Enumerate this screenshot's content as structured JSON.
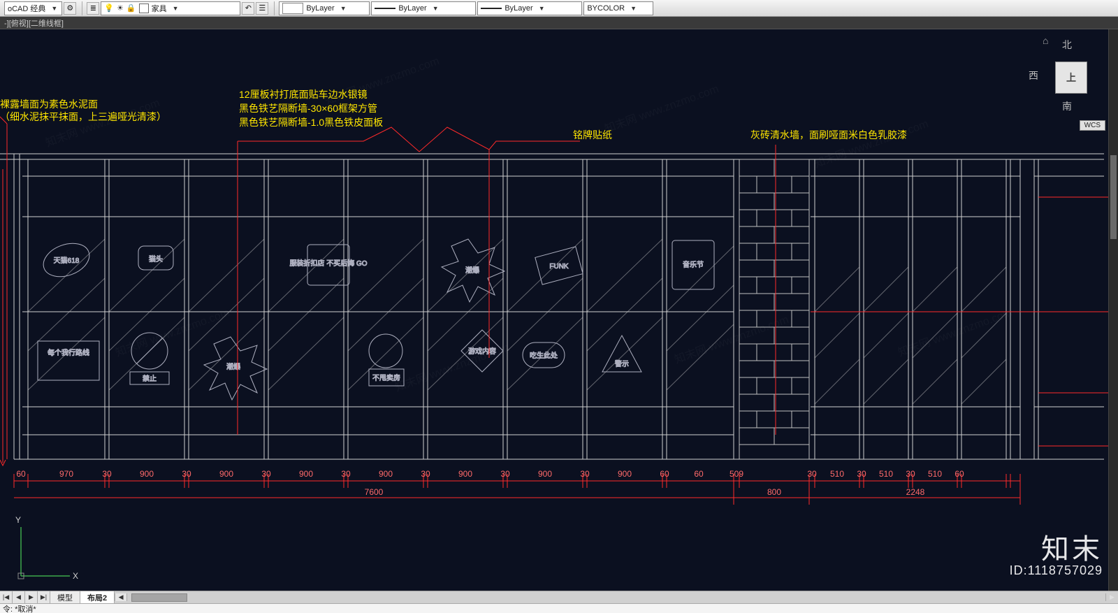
{
  "toolbar": {
    "workspace": "oCAD 经典",
    "layer_dropdown": "家具",
    "linetype": "ByLayer",
    "lineweight": "ByLayer",
    "plotstyle": "ByLayer",
    "color": "BYCOLOR",
    "icons": {
      "bulb": "bulb-icon",
      "sun": "sun-icon",
      "lock": "lock-icon",
      "layer": "layer-icon",
      "layerprops": "layer-properties-icon",
      "layprev": "layer-previous-icon"
    }
  },
  "viewport_label": "-][俯视][二维线框]",
  "wcs_badge": "WCS",
  "viewcube": {
    "north": "北",
    "south": "南",
    "west": "西",
    "top": "上"
  },
  "annotations": {
    "note1a": "裸露墙面为素色水泥面",
    "note1b": "（细水泥抹平抹面，上三遍哑光清漆）",
    "note2a": "12厘板衬打底面贴车边水银镜",
    "note2b": "黑色铁艺隔断墙-30×60框架方管",
    "note2c": "黑色铁艺隔断墙-1.0黑色铁皮面板",
    "note3": "铭牌贴纸",
    "note4": "灰砖清水墙，面刷哑面米白色乳胶漆"
  },
  "dimensions": {
    "row1": [
      "60",
      "970",
      "30",
      "900",
      "30",
      "900",
      "30",
      "900",
      "30",
      "900",
      "30",
      "900",
      "30",
      "900",
      "30",
      "900",
      "60",
      "60",
      "509",
      "30",
      "510",
      "30",
      "510",
      "30",
      "510",
      "60"
    ],
    "total_left": "7600",
    "pier": "800",
    "total_right": "2248"
  },
  "decals": {
    "r1_c1": "天猫618",
    "r1_c2": "猫头",
    "r2_c4": "服装折扣店\\n不买后悔\\nGO",
    "r2_c7": "潮爆",
    "r2_c8": "FUNK",
    "r2_c9": "音乐节",
    "r3_c1": "每个我行路线",
    "r3_c2": "禁止",
    "r3_c3": "潮爆",
    "r3_c5": "不甩卖房",
    "r3_c6": "游戏内容",
    "r3_c7": "吃生此处",
    "r3_c8": "警示"
  },
  "ucs": {
    "x": "X",
    "y": "Y"
  },
  "tabs": {
    "model": "模型",
    "layout": "布局2"
  },
  "cmdline_prefix": "令:",
  "cmdline_value": "*取消*",
  "brand": "知末",
  "brand_id": "ID:1118757029",
  "watermark": "知末网 www.znzmo.com"
}
